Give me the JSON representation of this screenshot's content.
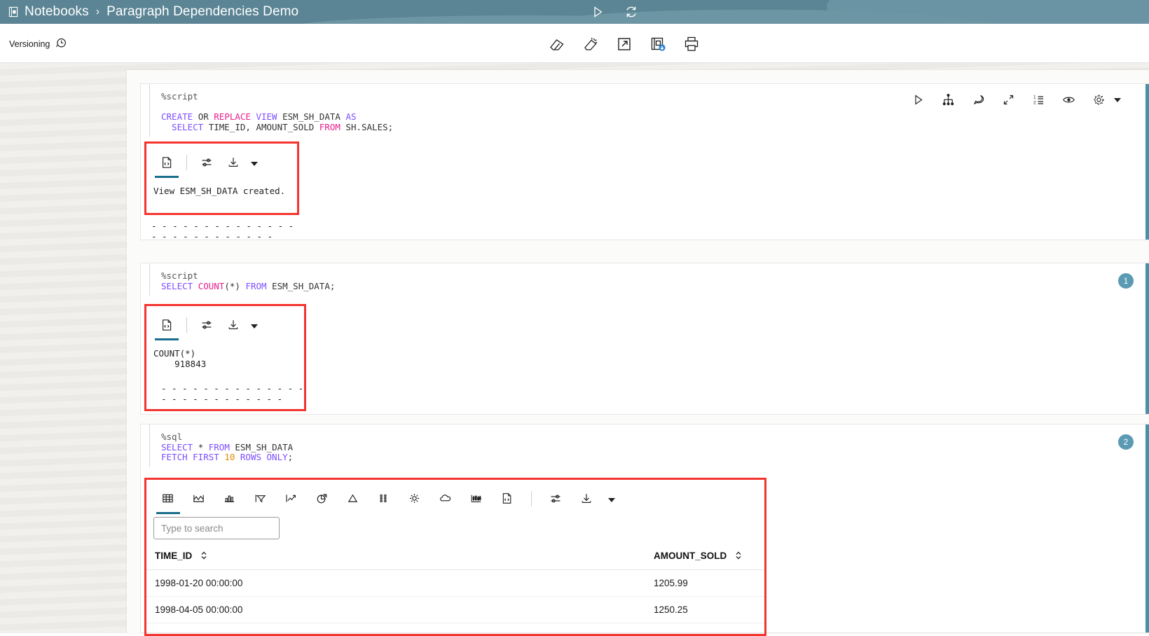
{
  "appbar": {
    "notebook_icon": "notebook-icon",
    "breadcrumb_root": "Notebooks",
    "breadcrumb_sep": "›",
    "breadcrumb_current": "Paragraph Dependencies Demo",
    "actions": [
      {
        "name": "run-all-icon",
        "title": "Run All"
      },
      {
        "name": "refresh-icon",
        "title": "Refresh"
      }
    ],
    "bg_color": "#5b8494"
  },
  "subbar": {
    "versioning_label": "Versioning",
    "versioning_icon": "history-clock-icon",
    "actions": [
      {
        "name": "clear-results-icon",
        "title": "Clear Results"
      },
      {
        "name": "clear-output-icon",
        "title": "Clear All Output"
      },
      {
        "name": "open-external-icon",
        "title": "Open in New Window"
      },
      {
        "name": "save-notebook-icon",
        "title": "Save Notebook"
      },
      {
        "name": "print-icon",
        "title": "Print"
      }
    ]
  },
  "paragraphs": [
    {
      "id": "p1",
      "badge": "",
      "code_lines": [
        [
          {
            "t": "%script",
            "c": "k-magic"
          }
        ],
        [
          {
            "t": "",
            "c": "k-plain"
          }
        ],
        [
          {
            "t": "CREATE ",
            "c": "k-kw"
          },
          {
            "t": "OR ",
            "c": "k-plain"
          },
          {
            "t": "REPLACE ",
            "c": "k-kw2"
          },
          {
            "t": "VIEW ",
            "c": "k-kw"
          },
          {
            "t": "ESM_SH_DATA ",
            "c": "k-plain"
          },
          {
            "t": "AS",
            "c": "k-kw"
          }
        ],
        [
          {
            "t": "  SELECT ",
            "c": "k-kw"
          },
          {
            "t": "TIME_ID, AMOUNT_SOLD ",
            "c": "k-plain"
          },
          {
            "t": "FROM ",
            "c": "k-kw2"
          },
          {
            "t": "SH.SALES;",
            "c": "k-plain"
          }
        ]
      ],
      "tools": [
        {
          "name": "run-paragraph-icon",
          "title": "Run"
        },
        {
          "name": "dependencies-icon",
          "title": "Paragraph Dependencies"
        },
        {
          "name": "comment-icon",
          "title": "Comment"
        },
        {
          "name": "expand-icon",
          "title": "Expand"
        },
        {
          "name": "order-list-icon",
          "title": "Execution Order"
        },
        {
          "name": "visibility-icon",
          "title": "Show/Hide"
        },
        {
          "name": "settings-gear-icon",
          "title": "Settings"
        }
      ],
      "result": {
        "tabs": [
          {
            "name": "raw-output-tab",
            "icon": "document-code-icon",
            "active": true
          }
        ],
        "controls": [
          {
            "name": "output-settings-icon",
            "icon": "sliders-icon"
          },
          {
            "name": "download-icon",
            "icon": "download-icon"
          }
        ],
        "text": "View ESM_SH_DATA created.",
        "divider": "- - - - - - - - - - - - - - - - - - - - - - - - - -"
      }
    },
    {
      "id": "p2",
      "badge": "1",
      "code_lines": [
        [
          {
            "t": "%script",
            "c": "k-magic"
          }
        ],
        [
          {
            "t": "SELECT ",
            "c": "k-kw"
          },
          {
            "t": "COUNT",
            "c": "k-kw2"
          },
          {
            "t": "(*) ",
            "c": "k-plain"
          },
          {
            "t": "FROM ",
            "c": "k-kw"
          },
          {
            "t": "ESM_SH_DATA;",
            "c": "k-plain"
          }
        ]
      ],
      "result": {
        "tabs": [
          {
            "name": "raw-output-tab",
            "icon": "document-code-icon",
            "active": true
          }
        ],
        "text": "COUNT(*)\n    918843",
        "divider": "- - - - - - - - - - - - - - - - - - - - - - - - - -"
      }
    },
    {
      "id": "p3",
      "badge": "2",
      "code_lines": [
        [
          {
            "t": "%sql",
            "c": "k-magic"
          }
        ],
        [
          {
            "t": "SELECT ",
            "c": "k-kw"
          },
          {
            "t": "* ",
            "c": "k-plain"
          },
          {
            "t": "FROM ",
            "c": "k-kw"
          },
          {
            "t": "ESM_SH_DATA",
            "c": "k-plain"
          }
        ],
        [
          {
            "t": "FETCH FIRST ",
            "c": "k-kw"
          },
          {
            "t": "10 ",
            "c": "k-num"
          },
          {
            "t": "ROWS ONLY",
            "c": "k-kw"
          },
          {
            "t": ";",
            "c": "k-plain"
          }
        ]
      ],
      "viz_tabs": [
        {
          "name": "grid-view-tab",
          "icon": "grid-icon",
          "active": true
        },
        {
          "name": "area-chart-tab",
          "icon": "area-chart-icon",
          "active": false
        },
        {
          "name": "bar-chart-tab",
          "icon": "bar-chart-icon",
          "active": false
        },
        {
          "name": "funnel-chart-tab",
          "icon": "funnel-icon",
          "active": false
        },
        {
          "name": "line-chart-tab",
          "icon": "line-chart-icon",
          "active": false
        },
        {
          "name": "pie-chart-tab",
          "icon": "pie-chart-icon",
          "active": false
        },
        {
          "name": "pyramid-chart-tab",
          "icon": "pyramid-icon",
          "active": false
        },
        {
          "name": "scatter-chart-tab",
          "icon": "scatter-icon",
          "active": false
        },
        {
          "name": "sunburst-chart-tab",
          "icon": "sun-icon",
          "active": false
        },
        {
          "name": "cloud-chart-tab",
          "icon": "cloud-icon",
          "active": false
        },
        {
          "name": "candlestick-chart-tab",
          "icon": "candlestick-icon",
          "active": false
        },
        {
          "name": "raw-output-tab",
          "icon": "document-code-icon",
          "active": false
        }
      ],
      "viz_controls": [
        {
          "name": "output-settings-icon",
          "icon": "sliders-icon"
        },
        {
          "name": "download-icon",
          "icon": "download-icon"
        }
      ],
      "search_placeholder": "Type to search",
      "search_value": "",
      "table": {
        "columns": [
          "TIME_ID",
          "AMOUNT_SOLD"
        ],
        "rows": [
          [
            "1998-01-20 00:00:00",
            "1205.99"
          ],
          [
            "1998-04-05 00:00:00",
            "1250.25"
          ]
        ]
      }
    }
  ],
  "colors": {
    "teal": "#5b8494",
    "accent_bar": "#4a90a8",
    "badge": "#5b9ab3",
    "highlight_red": "#f4342f",
    "tab_underline": "#1a6d8c"
  }
}
